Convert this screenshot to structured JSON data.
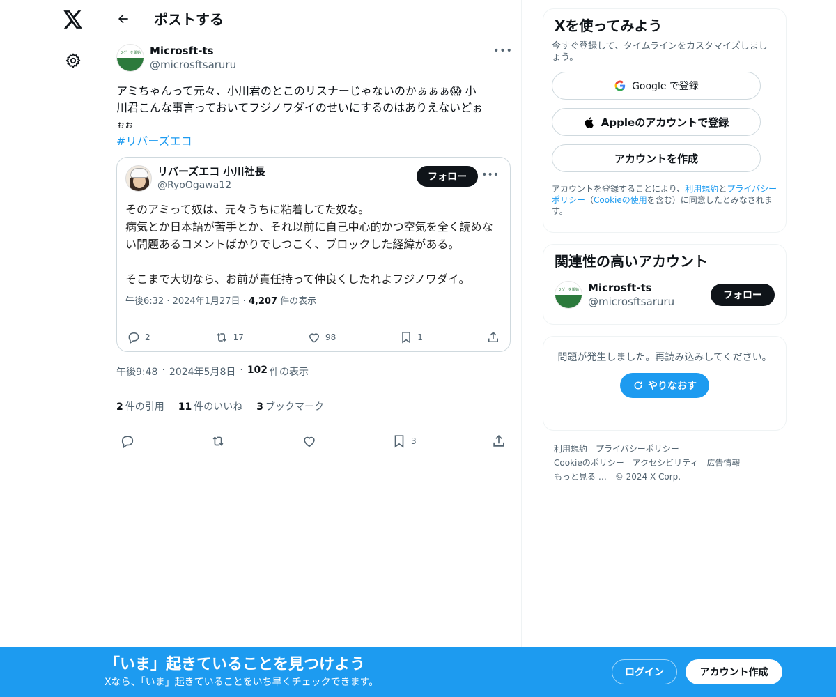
{
  "nav": {
    "logo_icon": "x-logo-icon",
    "settings_icon": "gear-icon"
  },
  "header": {
    "title": "ポストする"
  },
  "post": {
    "author_name": "Microsft-ts",
    "author_handle": "@microsftsaruru",
    "avatar_text": "ラゲーを開始",
    "text_line1": "アミちゃんって元々、小川君のとこのリスナーじゃないのかぁぁぁ😱 小",
    "text_line2": "川君こんな事言っておいてフジノワダイのせいにするのはありえないどぉ",
    "text_line3": "ぉぉ",
    "hashtag": "#リバーズエコ",
    "time": "午後9:48",
    "dot1": "·",
    "date": "2024年5月8日",
    "dot2": "·",
    "views_count": "102",
    "views_label": "件の表示",
    "quotes_count": "2",
    "quotes_label": "件の引用",
    "likes_count": "11",
    "likes_label": "件のいいね",
    "bookmarks_count": "3",
    "bookmarks_label": "ブックマーク",
    "bookmark_action_count": "3"
  },
  "quote": {
    "name": "リバーズエコ 小川社長",
    "handle": "@RyoOgawa12",
    "follow_label": "フォロー",
    "text": "そのアミって奴は、元々うちに粘着してた奴な。\n病気とか日本語が苦手とか、それ以前に自己中心的かつ空気を全く読めな\nい問題あるコメントばかりでしつこく、ブロックした経緯がある。\n\nそこまで大切なら、お前が責任持って仲良くしたれよフジノワダイ。",
    "meta_time": "午後6:32 · 2024年1月27日 · ",
    "meta_views": "4,207",
    "meta_views_label": " 件の表示",
    "replies": "2",
    "reposts": "17",
    "likes": "98",
    "bookmarks": "1"
  },
  "signup": {
    "title": "Xを使ってみよう",
    "subtitle": "今すぐ登録して、タイムラインをカスタマイズしましょう。",
    "google_label": "Google で登録",
    "apple_label": "Appleのアカウントで登録",
    "create_label": "アカウントを作成",
    "legal_1": "アカウントを登録することにより、",
    "legal_terms": "利用規約",
    "legal_2": "と",
    "legal_privacy": "プライバシーポリシー",
    "legal_3": "（",
    "legal_cookie": "Cookieの使用",
    "legal_4": "を含む）に同意したとみなされます。"
  },
  "related": {
    "title": "関連性の高いアカウント",
    "name": "Microsft-ts",
    "handle": "@microsftsaruru",
    "follow_label": "フォロー"
  },
  "error": {
    "text": "問題が発生しました。再読み込みしてください。",
    "retry_label": "やりなおす"
  },
  "footer": {
    "terms": "利用規約",
    "privacy": "プライバシーポリシー",
    "cookie": "Cookieのポリシー",
    "accessibility": "アクセシビリティ",
    "ads": "広告情報",
    "more": "もっと見る …",
    "copyright": "© 2024 X Corp."
  },
  "bottom": {
    "title": "「いま」起きていることを見つけよう",
    "subtitle": "Xなら、「いま」起きていることをいち早くチェックできます。",
    "login_label": "ログイン",
    "create_label": "アカウント作成"
  },
  "colors": {
    "accent": "#1d9bf0",
    "text": "#0f1419",
    "muted": "#536471",
    "border": "#eff3f4"
  }
}
